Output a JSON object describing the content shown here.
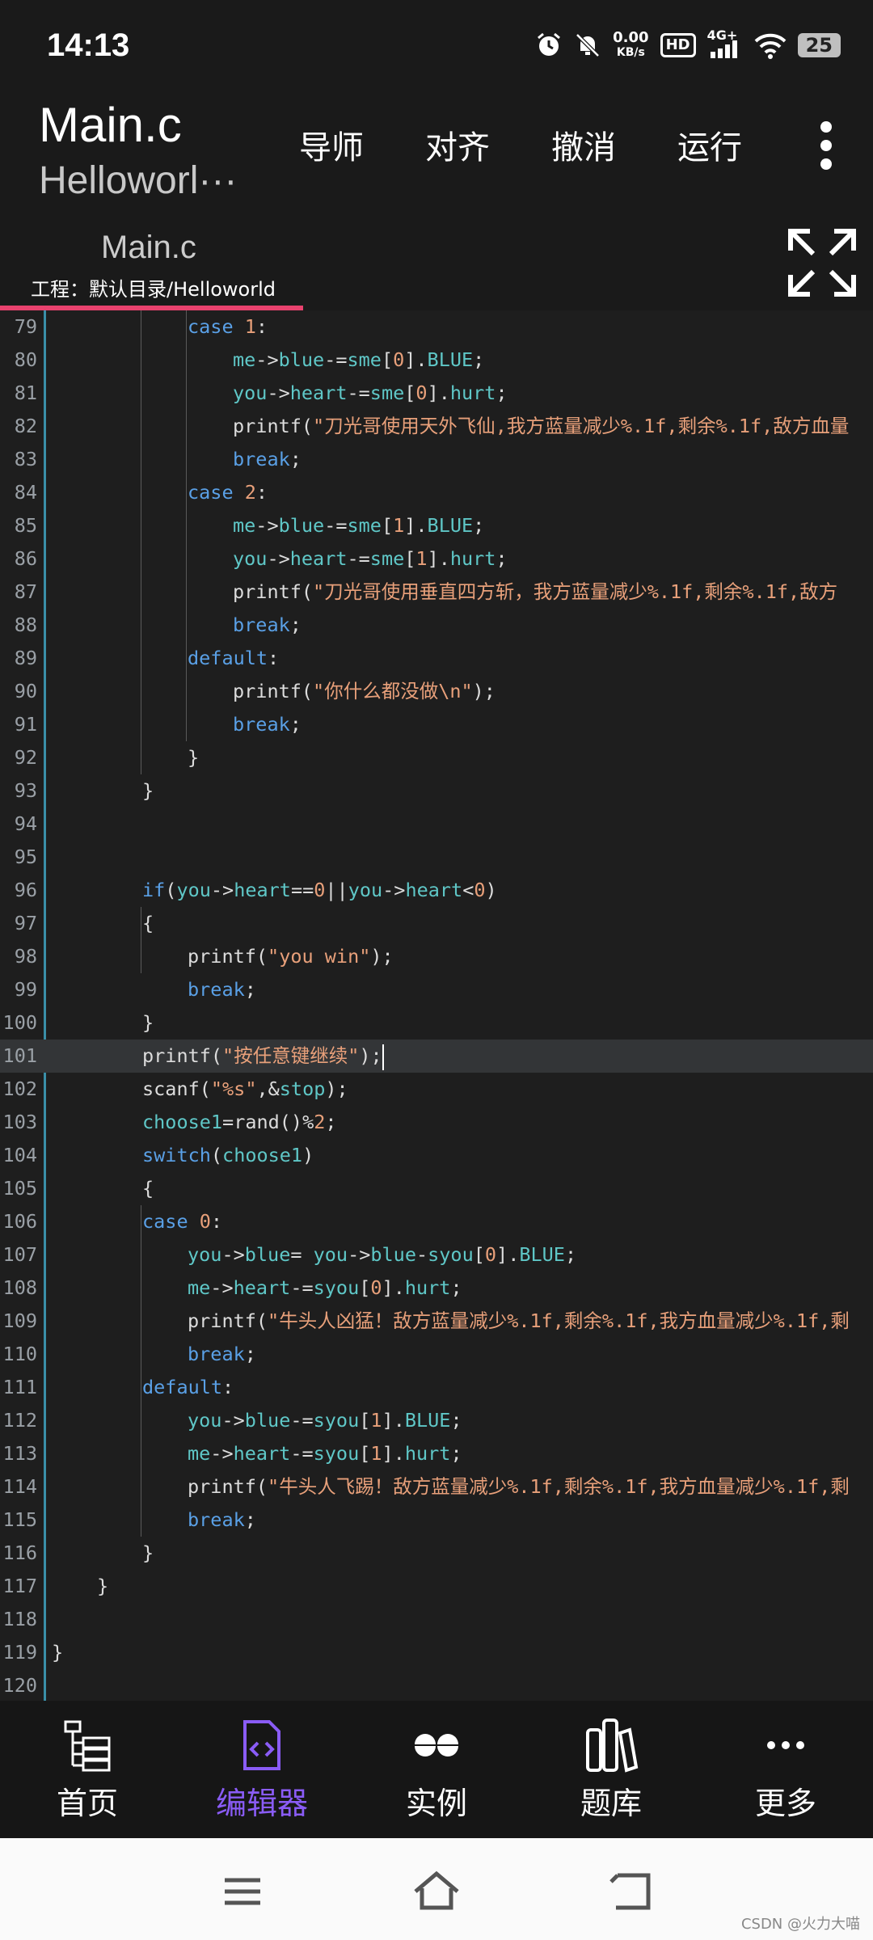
{
  "status_bar": {
    "time": "14:13",
    "net_speed_value": "0.00",
    "net_speed_unit": "KB/s",
    "hd_label": "HD",
    "network_label": "4G+",
    "battery_level": "25",
    "icons": [
      "alarm-icon",
      "mute-icon",
      "hd-icon",
      "signal-icon",
      "wifi-icon",
      "battery-icon"
    ]
  },
  "app_bar": {
    "file_title": "Main.c",
    "project_title": "Helloworl···",
    "actions": [
      "导师",
      "对齐",
      "撤消",
      "运行"
    ]
  },
  "tab": {
    "name": "Main.c",
    "path": "工程：默认目录/Helloworld",
    "accent_color": "#e8426e"
  },
  "editor": {
    "current_line": 101,
    "lines": [
      {
        "n": "79",
        "indent": 3,
        "html": "<span class='kw'>case</span> <span class='num'>1</span>:"
      },
      {
        "n": "80",
        "indent": 4,
        "html": "<span class='var'>me</span>-><span class='var'>blue</span>-=<span class='var'>sme</span>[<span class='num'>0</span>].<span class='var'>BLUE</span>;"
      },
      {
        "n": "81",
        "indent": 4,
        "html": "<span class='var'>you</span>-><span class='var'>heart</span>-=<span class='var'>sme</span>[<span class='num'>0</span>].<span class='var'>hurt</span>;"
      },
      {
        "n": "82",
        "indent": 4,
        "html": "printf(<span class='str'>\"刀光哥使用天外飞仙,我方蓝量减少%.1f,剩余%.1f,敌方血量</span>"
      },
      {
        "n": "83",
        "indent": 4,
        "html": "<span class='kw'>break</span>;"
      },
      {
        "n": "84",
        "indent": 3,
        "html": "<span class='kw'>case</span> <span class='num'>2</span>:"
      },
      {
        "n": "85",
        "indent": 4,
        "html": "<span class='var'>me</span>-><span class='var'>blue</span>-=<span class='var'>sme</span>[<span class='num'>1</span>].<span class='var'>BLUE</span>;"
      },
      {
        "n": "86",
        "indent": 4,
        "html": "<span class='var'>you</span>-><span class='var'>heart</span>-=<span class='var'>sme</span>[<span class='num'>1</span>].<span class='var'>hurt</span>;"
      },
      {
        "n": "87",
        "indent": 4,
        "html": "printf(<span class='str'>\"刀光哥使用垂直四方斩，我方蓝量减少%.1f,剩余%.1f,敌方</span>"
      },
      {
        "n": "88",
        "indent": 4,
        "html": "<span class='kw'>break</span>;"
      },
      {
        "n": "89",
        "indent": 3,
        "html": "<span class='kw'>default</span>:"
      },
      {
        "n": "90",
        "indent": 4,
        "html": "printf(<span class='str'>\"你什么都没做\\n\"</span>);"
      },
      {
        "n": "91",
        "indent": 4,
        "html": "<span class='kw'>break</span>;"
      },
      {
        "n": "92",
        "indent": 3,
        "html": "}"
      },
      {
        "n": "93",
        "indent": 2,
        "html": "}"
      },
      {
        "n": "94",
        "indent": 0,
        "html": ""
      },
      {
        "n": "95",
        "indent": 0,
        "html": ""
      },
      {
        "n": "96",
        "indent": 2,
        "html": "<span class='kw'>if</span>(<span class='var'>you</span>-><span class='var'>heart</span>==<span class='num'>0</span>||<span class='var'>you</span>-><span class='var'>heart</span>&lt;<span class='num'>0</span>)"
      },
      {
        "n": "97",
        "indent": 2,
        "html": "{"
      },
      {
        "n": "98",
        "indent": 3,
        "html": "printf(<span class='str'>\"you win\"</span>);"
      },
      {
        "n": "99",
        "indent": 3,
        "html": "<span class='kw'>break</span>;"
      },
      {
        "n": "100",
        "indent": 2,
        "html": "}"
      },
      {
        "n": "101",
        "indent": 2,
        "html": "printf(<span class='str'>\"按任意键继续\"</span>);<span class='cursor'></span>"
      },
      {
        "n": "102",
        "indent": 2,
        "html": "scanf(<span class='str'>\"%s\"</span>,&amp;<span class='var'>stop</span>);"
      },
      {
        "n": "103",
        "indent": 2,
        "html": "<span class='var'>choose1</span>=rand()%<span class='num'>2</span>;"
      },
      {
        "n": "104",
        "indent": 2,
        "html": "<span class='kw'>switch</span>(<span class='var'>choose1</span>)"
      },
      {
        "n": "105",
        "indent": 2,
        "html": "{"
      },
      {
        "n": "106",
        "indent": 2,
        "html": "<span class='kw'>case</span> <span class='num'>0</span>:"
      },
      {
        "n": "107",
        "indent": 3,
        "html": "<span class='var'>you</span>-><span class='var'>blue</span>= <span class='var'>you</span>-><span class='var'>blue</span>-<span class='var'>syou</span>[<span class='num'>0</span>].<span class='var'>BLUE</span>;"
      },
      {
        "n": "108",
        "indent": 3,
        "html": "<span class='var'>me</span>-><span class='var'>heart</span>-=<span class='var'>syou</span>[<span class='num'>0</span>].<span class='var'>hurt</span>;"
      },
      {
        "n": "109",
        "indent": 3,
        "html": "printf(<span class='str'>\"牛头人凶猛！敌方蓝量减少%.1f,剩余%.1f,我方血量减少%.1f,剩</span>"
      },
      {
        "n": "110",
        "indent": 3,
        "html": "<span class='kw'>break</span>;"
      },
      {
        "n": "111",
        "indent": 2,
        "html": "<span class='kw'>default</span>:"
      },
      {
        "n": "112",
        "indent": 3,
        "html": "<span class='var'>you</span>-><span class='var'>blue</span>-=<span class='var'>syou</span>[<span class='num'>1</span>].<span class='var'>BLUE</span>;"
      },
      {
        "n": "113",
        "indent": 3,
        "html": "<span class='var'>me</span>-><span class='var'>heart</span>-=<span class='var'>syou</span>[<span class='num'>1</span>].<span class='var'>hurt</span>;"
      },
      {
        "n": "114",
        "indent": 3,
        "html": "printf(<span class='str'>\"牛头人飞踢！敌方蓝量减少%.1f,剩余%.1f,我方血量减少%.1f,剩</span>"
      },
      {
        "n": "115",
        "indent": 3,
        "html": "<span class='kw'>break</span>;"
      },
      {
        "n": "116",
        "indent": 2,
        "html": "}"
      },
      {
        "n": "117",
        "indent": 1,
        "html": "}"
      },
      {
        "n": "118",
        "indent": 0,
        "html": ""
      },
      {
        "n": "119",
        "indent": 0,
        "html": "}"
      },
      {
        "n": "120",
        "indent": 0,
        "html": ""
      }
    ]
  },
  "bottom_nav": {
    "items": [
      {
        "label": "首页",
        "icon": "home-tree-icon",
        "active": false
      },
      {
        "label": "编辑器",
        "icon": "editor-code-icon",
        "active": true
      },
      {
        "label": "实例",
        "icon": "examples-icon",
        "active": false
      },
      {
        "label": "题库",
        "icon": "books-icon",
        "active": false
      },
      {
        "label": "更多",
        "icon": "more-icon",
        "active": false
      }
    ],
    "active_color": "#8a5cf6"
  },
  "system_nav": {
    "buttons": [
      "menu-icon",
      "home-icon",
      "back-icon"
    ]
  },
  "watermark": "CSDN @火力大喵"
}
